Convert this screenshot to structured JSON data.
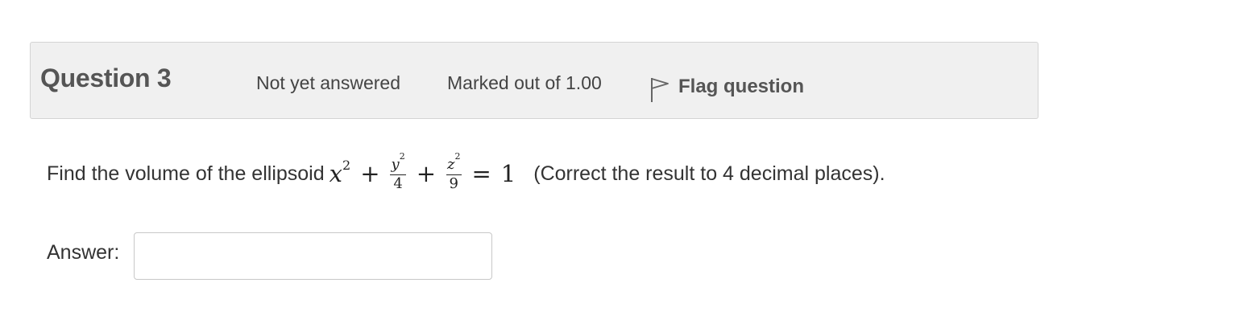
{
  "question": {
    "title": "Question 3",
    "state": "Not yet answered",
    "grade": "Marked out of 1.00",
    "flag_label": "Flag question",
    "flag_icon": "flag-outline-icon"
  },
  "prompt": {
    "before": "Find the volume of the ellipsoid",
    "math": {
      "x": "x",
      "x_exp": "2",
      "plus1": "+",
      "y": "y",
      "y_exp": "2",
      "y_den": "4",
      "plus2": "+",
      "z": "z",
      "z_exp": "2",
      "z_den": "9",
      "equals": "=",
      "rhs": "1"
    },
    "after": "(Correct the result to 4 decimal places)."
  },
  "answer": {
    "label": "Answer:",
    "value": ""
  },
  "colors": {
    "info_bg": "#f0f0f0",
    "info_border": "#d4d4d4",
    "text": "#333333"
  }
}
